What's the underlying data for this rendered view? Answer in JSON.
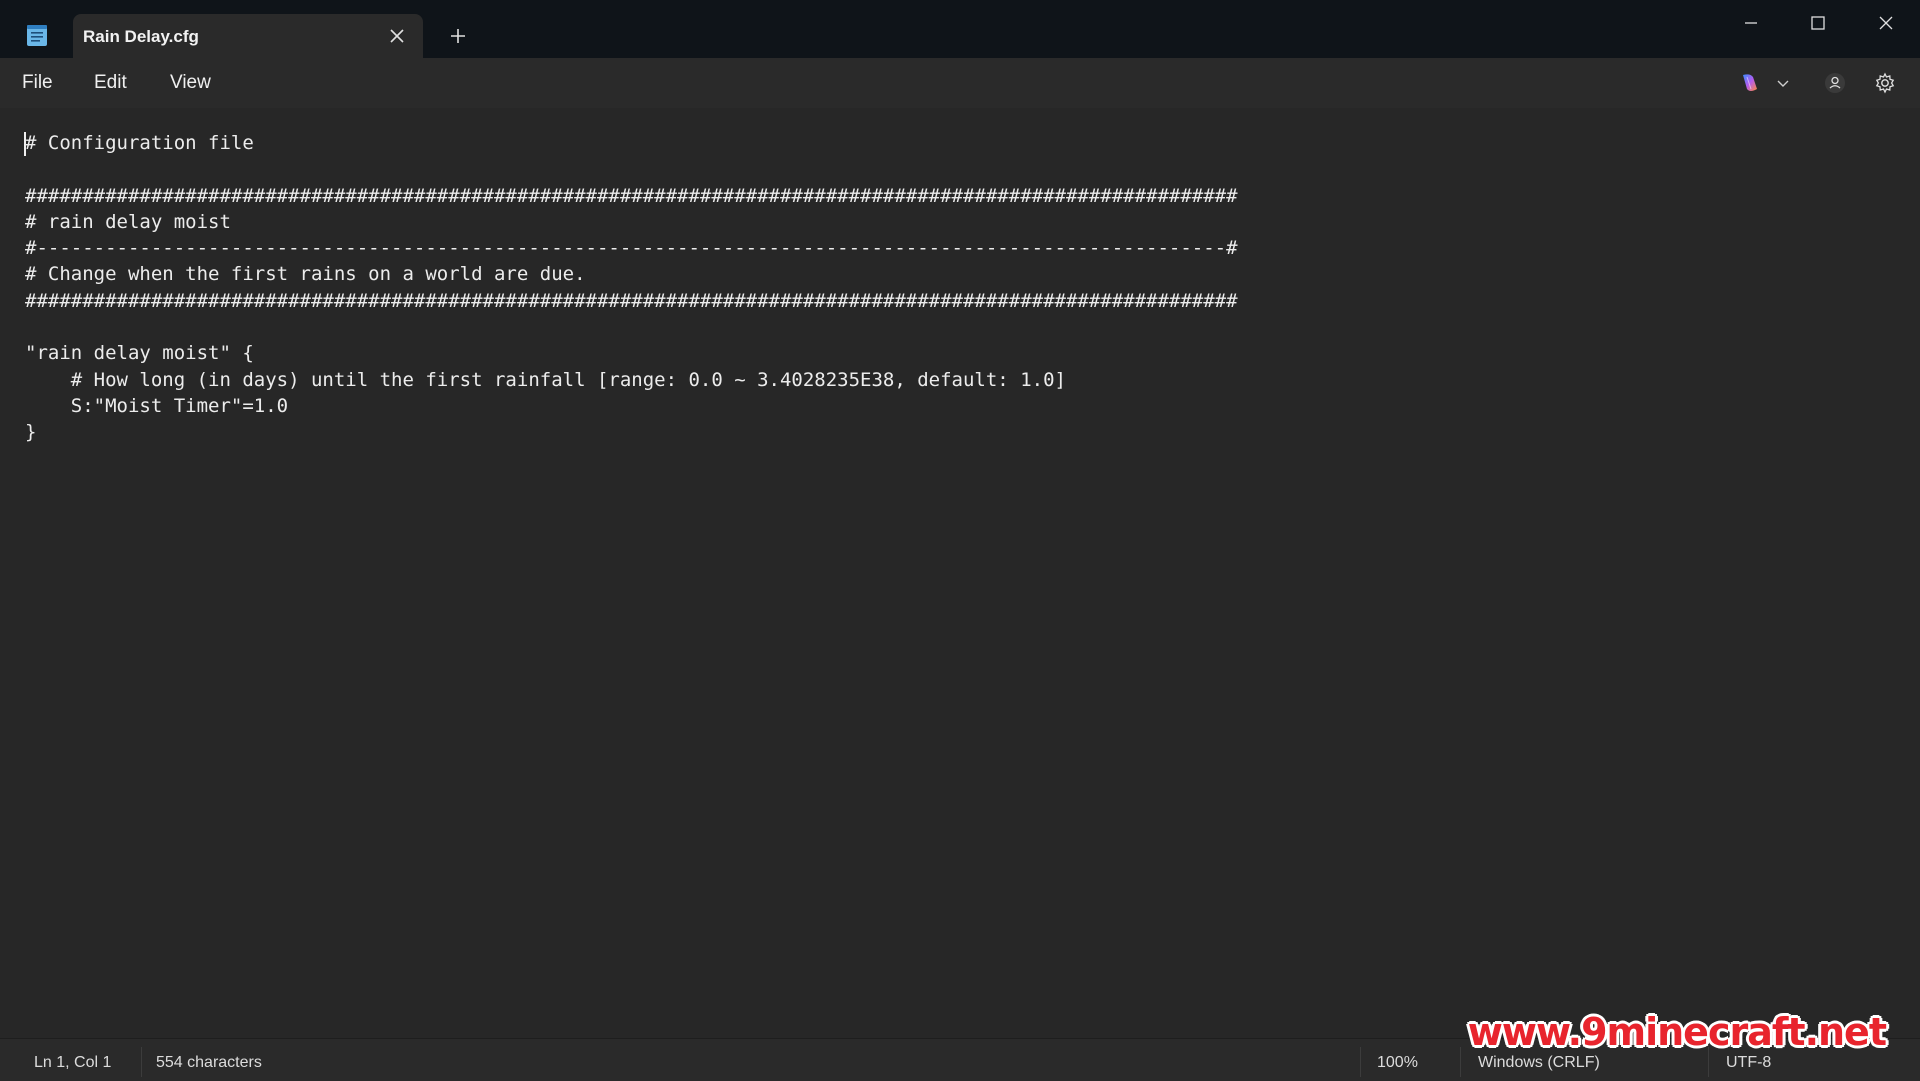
{
  "tab": {
    "title": "Rain Delay.cfg"
  },
  "menu": {
    "file": "File",
    "edit": "Edit",
    "view": "View"
  },
  "editor": {
    "lines": [
      "# Configuration file",
      "",
      "##########################################################################################################",
      "# rain delay moist",
      "#--------------------------------------------------------------------------------------------------------#",
      "# Change when the first rains on a world are due.",
      "##########################################################################################################",
      "",
      "\"rain delay moist\" {",
      "    # How long (in days) until the first rainfall [range: 0.0 ~ 3.4028235E38, default: 1.0]",
      "    S:\"Moist Timer\"=1.0",
      "}"
    ]
  },
  "status": {
    "position": "Ln 1, Col 1",
    "characters": "554 characters",
    "zoom": "100%",
    "line_ending": "Windows (CRLF)",
    "encoding": "UTF-8"
  },
  "watermark": "www.9minecraft.net",
  "icons": {
    "app": "notepad-icon",
    "copilot": "copilot-icon",
    "account": "account-icon",
    "settings": "gear-icon"
  }
}
